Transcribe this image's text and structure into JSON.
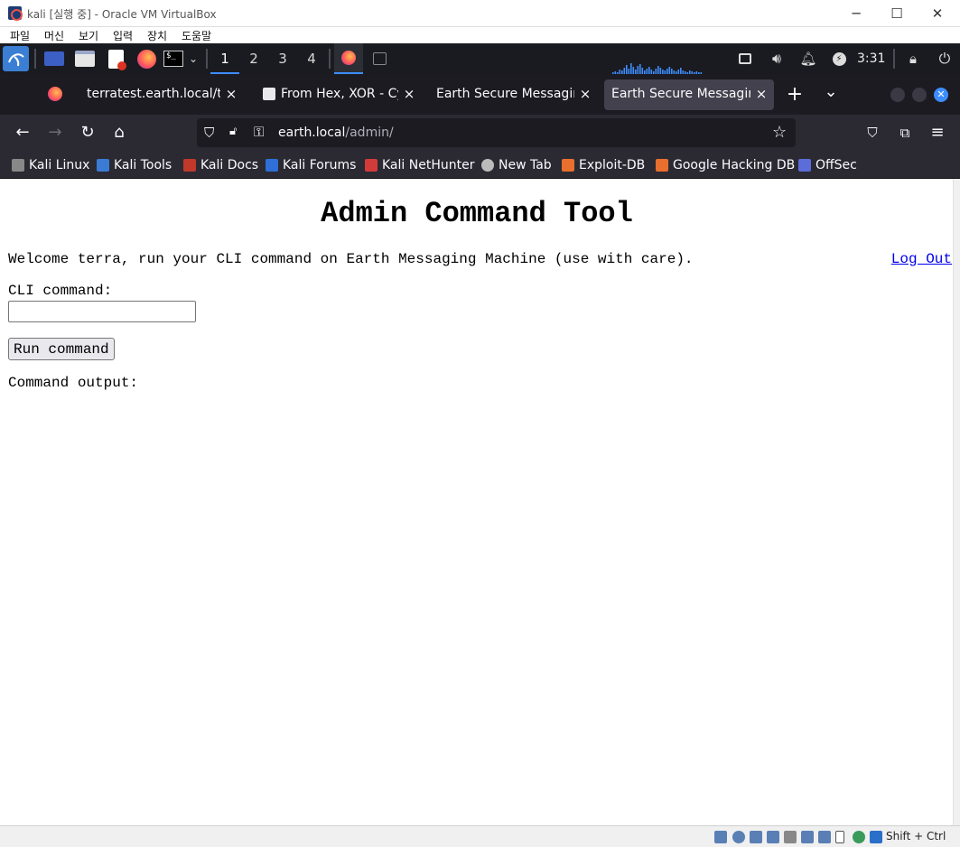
{
  "virtualbox": {
    "window_title": "kali [실행 중] - Oracle VM VirtualBox",
    "minimize": "─",
    "maximize": "☐",
    "close": "✕",
    "menu": [
      "파일",
      "머신",
      "보기",
      "입력",
      "장치",
      "도움말"
    ],
    "host_key": "Shift + Ctrl"
  },
  "kali_panel": {
    "workspaces": [
      "1",
      "2",
      "3",
      "4"
    ],
    "active_workspace": "1",
    "clock": "3:31",
    "accent_color": "#3d8dff"
  },
  "firefox": {
    "tabs": [
      {
        "label": "terratest.earth.local/testingnotes.txt",
        "active": false
      },
      {
        "label": "From Hex, XOR - CyberChef",
        "active": false
      },
      {
        "label": "Earth Secure Messaging",
        "active": false
      },
      {
        "label": "Earth Secure Messaging",
        "active": true
      }
    ],
    "tab_close": "×",
    "new_tab": "+",
    "tab_list": "⌄",
    "url": {
      "host": "earth.local",
      "path": "/admin/"
    },
    "bookmarks": [
      {
        "label": "Kali Linux",
        "color": "#888888"
      },
      {
        "label": "Kali Tools",
        "color": "#3a7bd5"
      },
      {
        "label": "Kali Docs",
        "color": "#c0392b"
      },
      {
        "label": "Kali Forums",
        "color": "#2e6fd8"
      },
      {
        "label": "Kali NetHunter",
        "color": "#d33b3b"
      },
      {
        "label": "New Tab",
        "color": "#bbbbbb"
      },
      {
        "label": "Exploit-DB",
        "color": "#e86f2d"
      },
      {
        "label": "Google Hacking DB",
        "color": "#e86f2d"
      },
      {
        "label": "OffSec",
        "color": "#5a6dd8"
      }
    ]
  },
  "page": {
    "title": "Admin Command Tool",
    "welcome": "Welcome terra, run your CLI command on Earth Messaging Machine (use with care).",
    "logout": "Log Out",
    "cli_label": "CLI command:",
    "cli_value": "",
    "run_button": "Run command",
    "output_label": "Command output:"
  }
}
